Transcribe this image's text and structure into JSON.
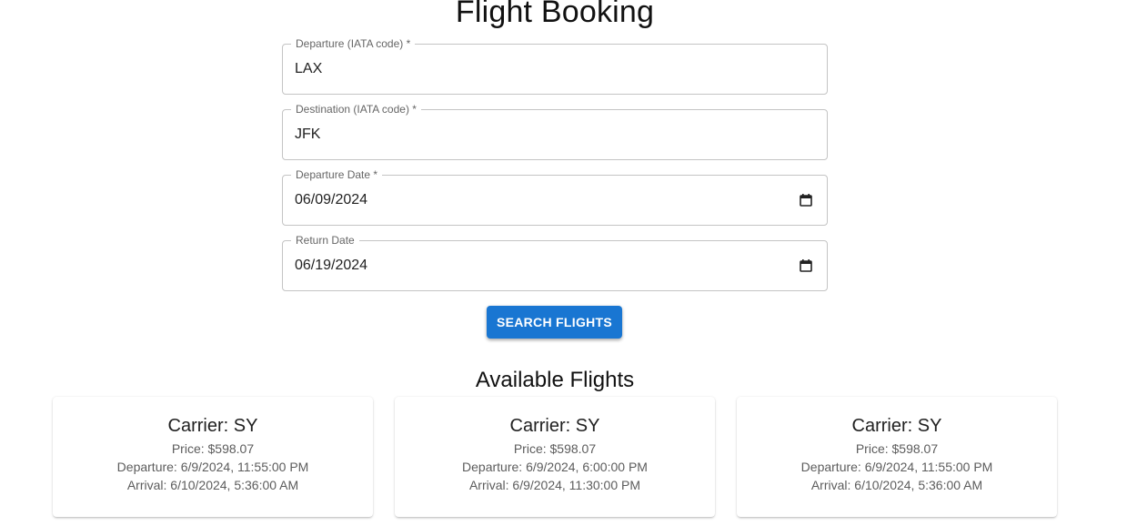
{
  "page": {
    "title": "Flight Booking"
  },
  "form": {
    "departure": {
      "label": "Departure (IATA code) *",
      "value": "LAX"
    },
    "destination": {
      "label": "Destination (IATA code) *",
      "value": "JFK"
    },
    "departure_date": {
      "label": "Departure Date *",
      "value": "06/09/2024",
      "icon": "calendar-icon"
    },
    "return_date": {
      "label": "Return Date",
      "value": "06/19/2024",
      "icon": "calendar-icon"
    },
    "search_button": "SEARCH FLIGHTS"
  },
  "results": {
    "title": "Available Flights",
    "flights": [
      {
        "carrier": "Carrier: SY",
        "price": "Price: $598.07",
        "departure": "Departure: 6/9/2024, 11:55:00 PM",
        "arrival": "Arrival: 6/10/2024, 5:36:00 AM"
      },
      {
        "carrier": "Carrier: SY",
        "price": "Price: $598.07",
        "departure": "Departure: 6/9/2024, 6:00:00 PM",
        "arrival": "Arrival: 6/9/2024, 11:30:00 PM"
      },
      {
        "carrier": "Carrier: SY",
        "price": "Price: $598.07",
        "departure": "Departure: 6/9/2024, 11:55:00 PM",
        "arrival": "Arrival: 6/10/2024, 5:36:00 AM"
      }
    ]
  },
  "colors": {
    "primary": "#1976d2",
    "border": "#c4c4c4",
    "label": "#666666"
  }
}
